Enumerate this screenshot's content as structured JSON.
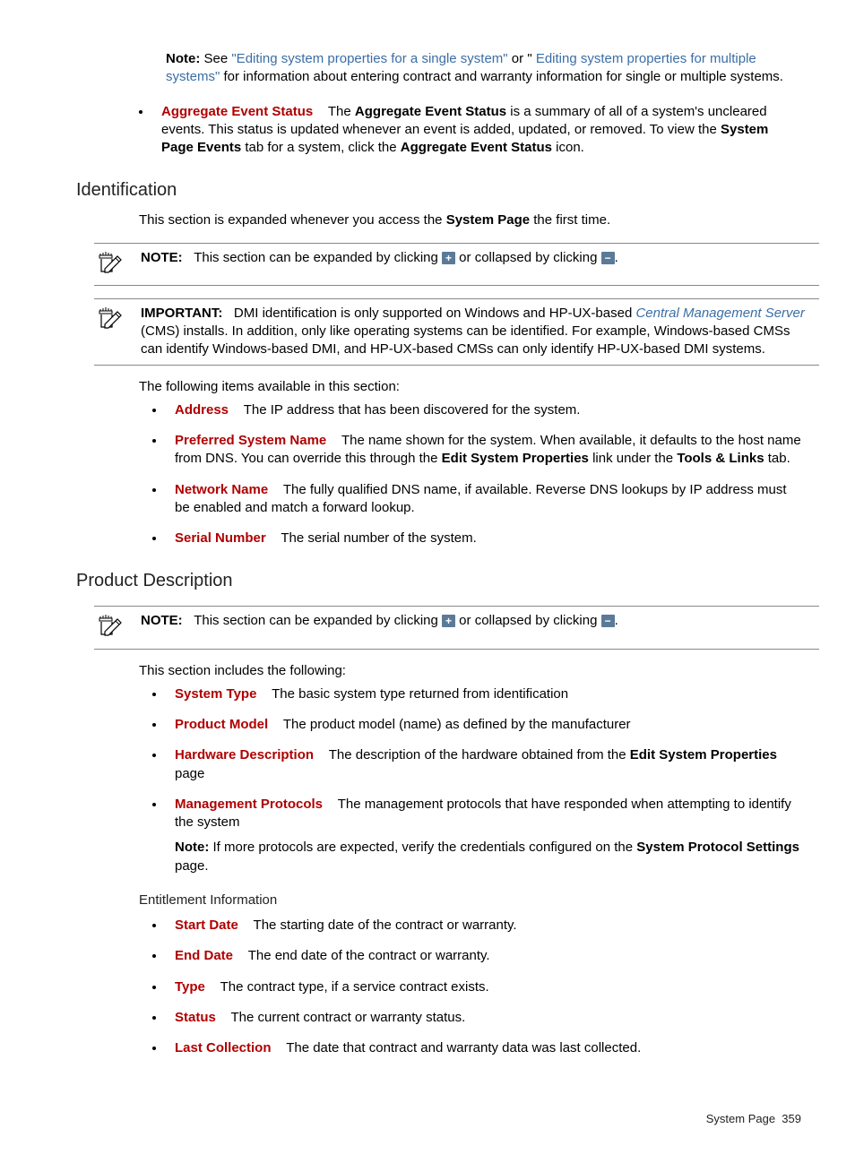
{
  "top_note": {
    "label": "Note:",
    "pre": " See ",
    "link1": "\"Editing system properties for a single system\"",
    "mid": " or \" ",
    "link2": "Editing system properties for multiple systems\"",
    "post": " for information about entering contract and warranty information for single or multiple systems."
  },
  "agg_event": {
    "term": "Aggregate Event Status",
    "p1a": "The ",
    "p1b": "Aggregate Event Status",
    "p1c": " is a summary of all of a system's uncleared events. This status is updated whenever an event is added, updated, or removed. To view the ",
    "p1d": "System Page Events",
    "p1e": " tab for a system, click the ",
    "p1f": "Aggregate Event Status",
    "p1g": " icon."
  },
  "identification": {
    "heading": "Identification",
    "intro_a": "This section is expanded whenever you access the ",
    "intro_b": "System Page",
    "intro_c": " the first time.",
    "note": {
      "label": "NOTE:",
      "a": "This section can be expanded by clicking ",
      "b": " or collapsed by clicking ",
      "c": "."
    },
    "important": {
      "label": "IMPORTANT:",
      "a": "DMI identification is only supported on Windows and HP-UX-based ",
      "link": "Central Management Server",
      "b": " (CMS) installs. In addition, only like operating systems can be identified. For example, Windows-based CMSs can identify Windows-based DMI, and HP-UX-based CMSs can only identify HP-UX-based DMI systems."
    },
    "items_intro": "The following items available in this section:",
    "items": [
      {
        "term": "Address",
        "desc": "The IP address that has been discovered for the system."
      },
      {
        "term": "Preferred System Name",
        "desc_a": "The name shown for the system. When available, it defaults to the host name from DNS. You can override this through the ",
        "bold1": "Edit System Properties",
        "desc_b": " link under the ",
        "bold2": "Tools & Links",
        "desc_c": " tab."
      },
      {
        "term": "Network Name",
        "desc": "The fully qualified DNS name, if available. Reverse DNS lookups by IP address must be enabled and match a forward lookup."
      },
      {
        "term": "Serial Number",
        "desc": "The serial number of the system."
      }
    ]
  },
  "product": {
    "heading": "Product Description",
    "note": {
      "label": "NOTE:",
      "a": "This section can be expanded by clicking ",
      "b": " or collapsed by clicking ",
      "c": "."
    },
    "intro": "This section includes the following:",
    "items": [
      {
        "term": "System Type",
        "desc": "The basic system type returned from identification"
      },
      {
        "term": "Product Model",
        "desc": "The product model (name) as defined by the manufacturer"
      },
      {
        "term": "Hardware Description",
        "desc_a": "The description of the hardware obtained from the ",
        "bold1": "Edit System Properties",
        "desc_b": " page"
      },
      {
        "term": "Management Protocols",
        "desc": "The management protocols that have responded when attempting to identify the system",
        "note_label": "Note:",
        "note_a": " If more protocols are expected, verify the credentials configured on the ",
        "note_bold": "System Protocol Settings",
        "note_b": " page."
      }
    ],
    "sub_heading": "Entitlement Information",
    "ent_items": [
      {
        "term": "Start Date",
        "desc": "The starting date of the contract or warranty."
      },
      {
        "term": "End Date",
        "desc": "The end date of the contract or warranty."
      },
      {
        "term": "Type",
        "desc": "The contract type, if a service contract exists."
      },
      {
        "term": "Status",
        "desc": "The current contract or warranty status."
      },
      {
        "term": "Last Collection",
        "desc": "The date that contract and warranty data was last collected."
      }
    ]
  },
  "footer": {
    "label": "System Page",
    "page": "359"
  },
  "icons": {
    "plus": "+",
    "minus": "−"
  }
}
